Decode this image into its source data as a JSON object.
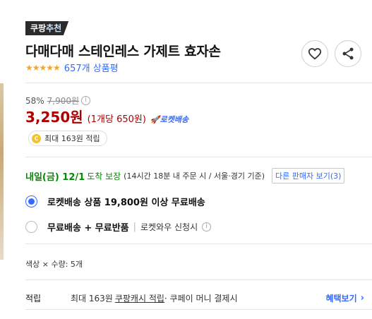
{
  "badge": {
    "prefix": "쿠팡",
    "accent": "추천"
  },
  "product": {
    "title": "다매다매 스테인레스 가제트 효자손",
    "stars_icon": "★★★★★",
    "review_count": "657개 상품평"
  },
  "price": {
    "discount_rate": "58%",
    "original_price": "7,900원",
    "info_icon": "i",
    "sale_price": "3,250원",
    "unit_price": "(1개당 650원)",
    "rocket_label": "🚀로켓배송"
  },
  "cash": {
    "coin_icon": "C",
    "text": "최대 163원 적립"
  },
  "delivery": {
    "date": "내일(금) 12/1",
    "guarantee": "도착 보장",
    "detail": "(14시간 18분  내 주문 시 / 서울·경기 기준)",
    "other_sellers": "다른 판매자 보기(3)"
  },
  "options": [
    {
      "label": "로켓배송 상품 19,800원 이상 무료배송",
      "checked": true
    },
    {
      "label": "무료배송 + 무료반품",
      "sub": "로켓와우 신청시",
      "checked": false
    }
  ],
  "spec": "색상 × 수량: 5개",
  "points": {
    "label": "적립",
    "text_before": "최대 163원",
    "link": "쿠팡캐시 적립",
    "text_after": " · 쿠페이 머니 결제시",
    "more": "혜택보기",
    "more_icon": "›"
  },
  "colors": {
    "accent": "#346aff",
    "price_red": "#ae0000",
    "delivery_green": "#008c00",
    "star": "#f5a623"
  }
}
